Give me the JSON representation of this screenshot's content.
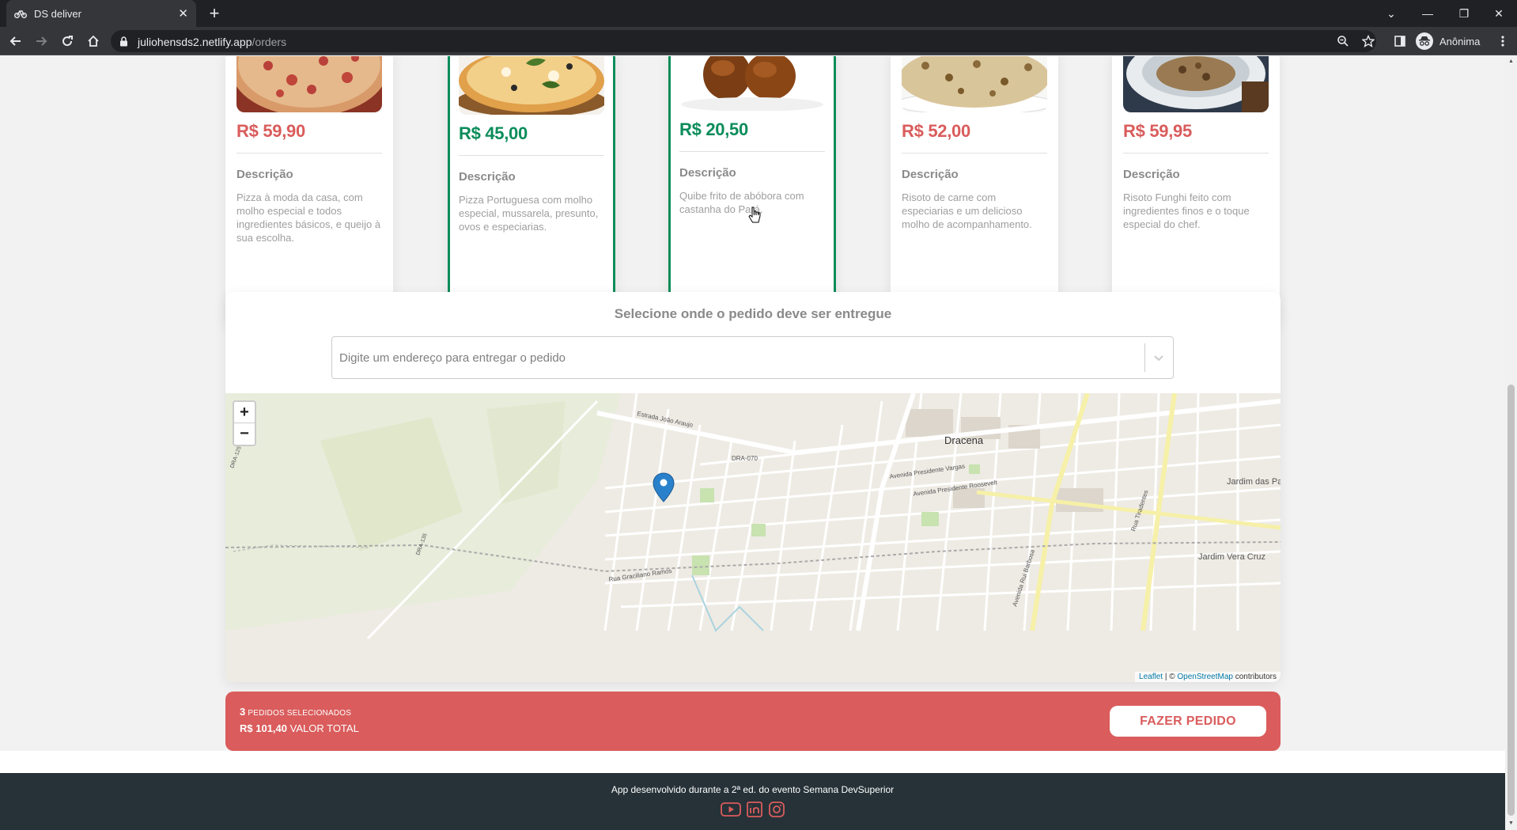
{
  "browser": {
    "tab_title": "DS deliver",
    "url_host": "juliohensds2.netlify.app",
    "url_path": "/orders",
    "profile_label": "Anônima"
  },
  "products": [
    {
      "price": "R$ 59,90",
      "price_color": "#da5c5c",
      "selected": false,
      "desc_title": "Descrição",
      "desc": "Pizza à moda da casa, com molho especial e todos ingredientes básicos, e queijo à sua escolha."
    },
    {
      "price": "R$ 45,00",
      "price_color": "#0b8c5a",
      "selected": true,
      "desc_title": "Descrição",
      "desc": "Pizza Portuguesa com molho especial, mussarela, presunto, ovos e especiarias."
    },
    {
      "price": "R$ 20,50",
      "price_color": "#0b8c5a",
      "selected": true,
      "desc_title": "Descrição",
      "desc": "Quibe frito de abóbora com castanha do Pará."
    },
    {
      "price": "R$ 52,00",
      "price_color": "#da5c5c",
      "selected": false,
      "desc_title": "Descrição",
      "desc": "Risoto de carne com especiarias e um delicioso molho de acompanhamento."
    },
    {
      "price": "R$ 59,95",
      "price_color": "#da5c5c",
      "selected": false,
      "desc_title": "Descrição",
      "desc": "Risoto Funghi feito com ingredientes finos e o toque especial do chef."
    }
  ],
  "location": {
    "title": "Selecione onde o pedido deve ser entregue",
    "placeholder": "Digite um endereço para entregar o pedido"
  },
  "map": {
    "zoom_in": "+",
    "zoom_out": "−",
    "attribution_leaflet": "Leaflet",
    "attribution_sep": " | © ",
    "attribution_osm": "OpenStreetMap",
    "attribution_tail": " contributors",
    "labels": {
      "city": "Dracena",
      "jardim_palmeiras": "Jardim das Palmeiras",
      "jardim_vera_cruz": "Jardim Vera Cruz",
      "dra070": "DRA-070",
      "estrada_joao_araujo": "Estrada João Araujo",
      "av_rui_barbosa": "Avenida Rui Barbosa",
      "rua_tiradentes": "Rua Tiradentes",
      "av_pres_vargas": "Avenida Presidente Vargas",
      "av_pres_roosevelt": "Avenida Presidente Roosevelt",
      "rua_graciliano": "Rua Graciliano Ramos",
      "dra125": "DRA-125",
      "dra135": "DRA-135"
    }
  },
  "summary": {
    "count": "3",
    "count_label": "PEDIDOS SELECIONADOS",
    "total": "R$ 101,40",
    "total_label": "VALOR TOTAL",
    "button": "FAZER PEDIDO"
  },
  "footer": {
    "text": "App desenvolvido durante a 2ª ed. do evento Semana DevSuperior"
  },
  "colors": {
    "primary": "#da5c5c",
    "selected_border": "#0b8c5a",
    "footer_bg": "#263238"
  }
}
